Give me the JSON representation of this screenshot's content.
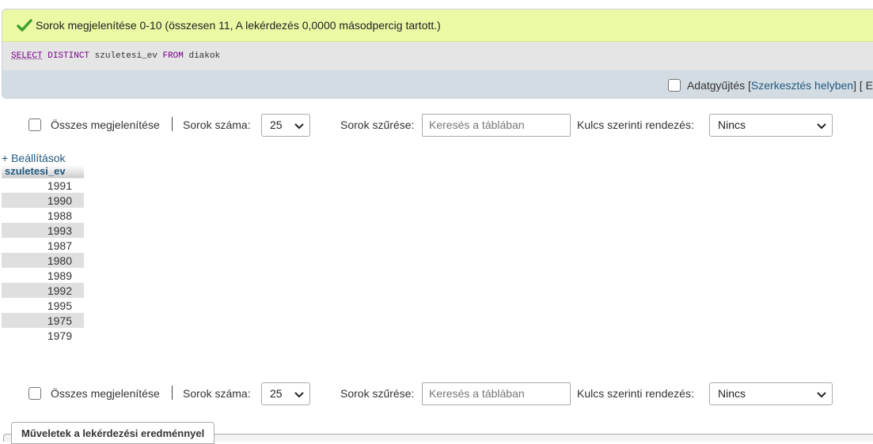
{
  "success_message": "Sorok megjelenítése 0-10 (összesen 11, A lekérdezés 0,0000 másodpercig tartott.)",
  "sql": {
    "select": "SELECT",
    "distinct": "DISTINCT",
    "column": "szuletesi_ev",
    "from": "FROM",
    "table": "diakok"
  },
  "toolbar": {
    "profiling_label": "Adatgyűjtés",
    "edit_inline_link": "Szerkesztés helyben",
    "bracket_open": "[",
    "bracket_close": "]",
    "trailing": "[ E"
  },
  "nav": {
    "show_all_label": "Összes megjelenítése",
    "row_count_label": "Sorok száma:",
    "row_count_value": "25",
    "filter_label": "Sorok szűrése:",
    "filter_placeholder": "Keresés a táblában",
    "sort_label": "Kulcs szerinti rendezés:",
    "sort_value": "Nincs"
  },
  "options_link": "+ Beállítások",
  "table": {
    "column_header": "szuletesi_ev",
    "rows": [
      "1991",
      "1990",
      "1988",
      "1993",
      "1987",
      "1980",
      "1989",
      "1992",
      "1995",
      "1975",
      "1979"
    ]
  },
  "operations_legend": "Műveletek a lekérdezési eredménnyel",
  "colors": {
    "success_bg": "#ebf8a4",
    "sql_bg": "#e5e5e5",
    "toolbar_bg": "#d3dce3",
    "link": "#235a81",
    "check": "#3ba130"
  },
  "icons": {
    "success": "check-icon",
    "dropdown": "chevron-down-icon"
  }
}
